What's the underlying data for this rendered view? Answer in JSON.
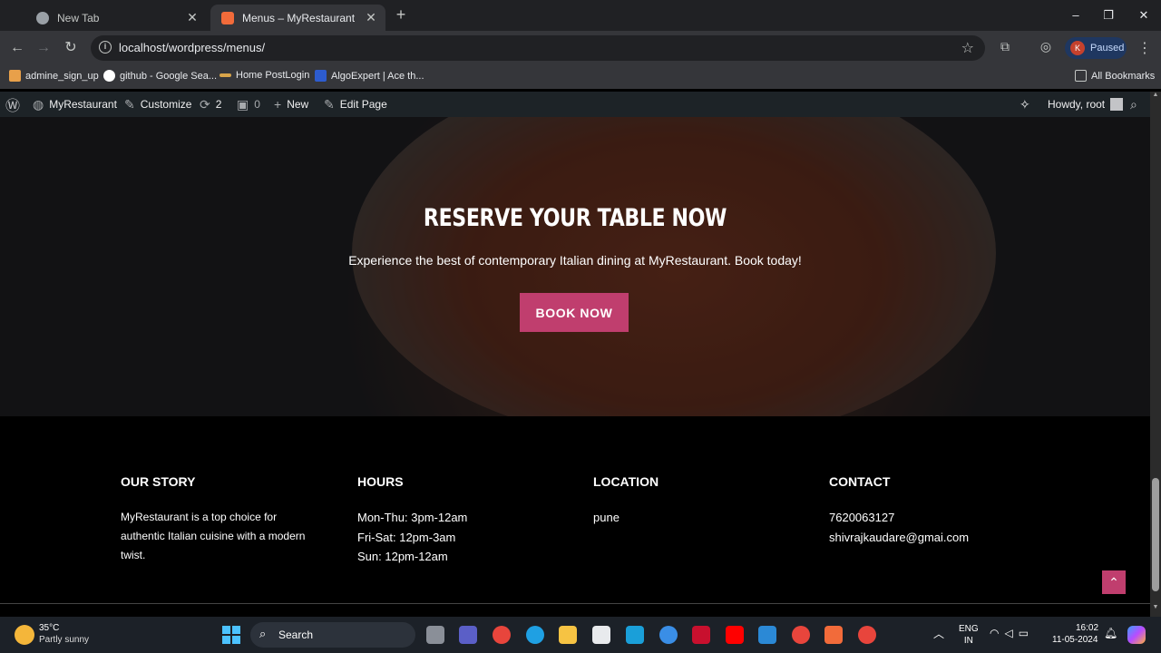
{
  "browser": {
    "tabs": [
      {
        "title": "New Tab",
        "active": false
      },
      {
        "title": "Menus – MyRestaurant",
        "active": true
      }
    ],
    "url": "localhost/wordpress/menus/",
    "profile_label": "Paused",
    "profile_initial": "K",
    "bookmarks": [
      "admine_sign_up",
      "github - Google Sea...",
      "Home PostLogin",
      "AlgoExpert | Ace th..."
    ],
    "all_bookmarks_label": "All Bookmarks"
  },
  "admin_bar": {
    "site_name": "MyRestaurant",
    "customize": "Customize",
    "updates_count": "2",
    "comments_count": "0",
    "new": "New",
    "edit_page": "Edit Page",
    "howdy": "Howdy, root"
  },
  "hero": {
    "title": "RESERVE YOUR TABLE NOW",
    "subtitle": "Experience the best of contemporary Italian dining at MyRestaurant. Book today!",
    "button": "BOOK NOW"
  },
  "footer": {
    "our_story": {
      "heading": "OUR STORY",
      "lines": [
        "MyRestaurant is a top choice for",
        "authentic Italian cuisine with a modern",
        "twist."
      ]
    },
    "hours": {
      "heading": "HOURS",
      "lines": [
        "Mon-Thu: 3pm-12am",
        "Fri-Sat: 12pm-3am",
        "Sun: 12pm-12am"
      ]
    },
    "location": {
      "heading": "LOCATION",
      "lines": [
        "pune"
      ]
    },
    "contact": {
      "heading": "CONTACT",
      "lines": [
        "7620063127",
        "shivrajkaudare@gmai.com"
      ]
    }
  },
  "taskbar": {
    "weather_temp": "35°C",
    "weather_desc": "Partly sunny",
    "search_label": "Search",
    "lang_top": "ENG",
    "lang_bottom": "IN",
    "time": "16:02",
    "date": "11-05-2024"
  },
  "colors": {
    "accent": "#c03e6e",
    "admin_bar": "#1d2327"
  }
}
